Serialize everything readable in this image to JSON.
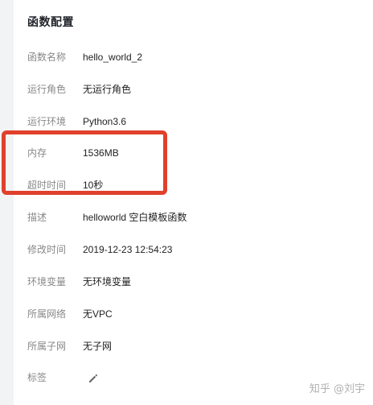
{
  "panel": {
    "title": "函数配置"
  },
  "fields": [
    {
      "label": "函数名称",
      "value": "hello_world_2"
    },
    {
      "label": "运行角色",
      "value": "无运行角色"
    },
    {
      "label": "运行环境",
      "value": "Python3.6"
    },
    {
      "label": "内存",
      "value": "1536MB"
    },
    {
      "label": "超时时间",
      "value": "10秒"
    },
    {
      "label": "描述",
      "value": "helloworld 空白模板函数"
    },
    {
      "label": "修改时间",
      "value": "2019-12-23 12:54:23"
    },
    {
      "label": "环境变量",
      "value": "无环境变量"
    },
    {
      "label": "所属网络",
      "value": "无VPC"
    },
    {
      "label": "所属子网",
      "value": "无子网"
    },
    {
      "label": "标签",
      "value": ""
    }
  ],
  "icons": {
    "tags_edit": "pencil-icon"
  },
  "colors": {
    "highlight": "#e0402c"
  },
  "watermark": "知乎 @刘宇"
}
